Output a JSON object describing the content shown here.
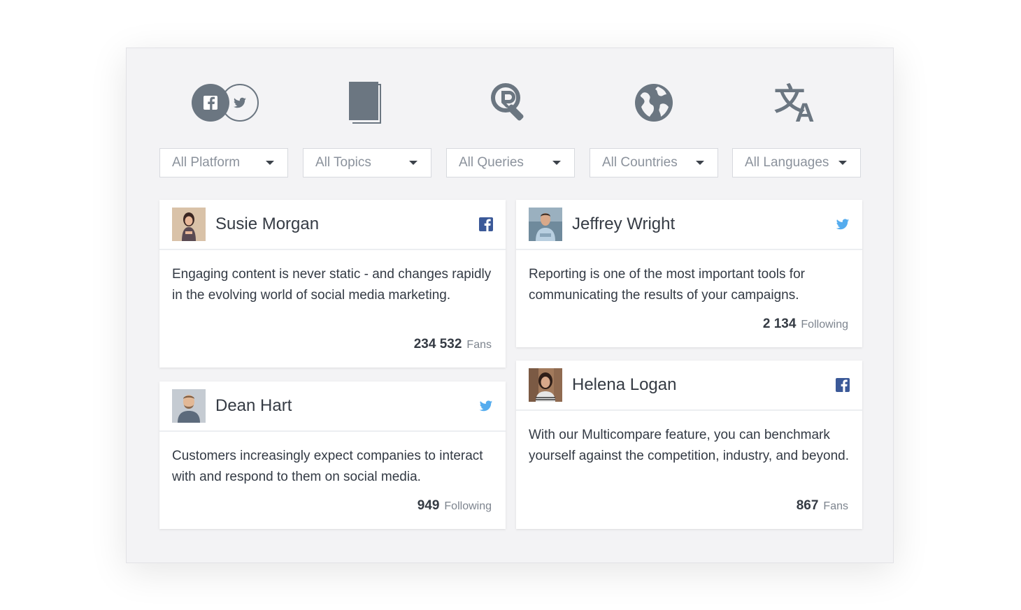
{
  "filters": [
    {
      "icon": "social-platforms-icon",
      "selected": "All Platform"
    },
    {
      "icon": "topics-book-icon",
      "selected": "All Topics"
    },
    {
      "icon": "query-search-icon",
      "selected": "All Queries"
    },
    {
      "icon": "globe-icon",
      "selected": "All Countries"
    },
    {
      "icon": "translate-icon",
      "selected": "All Languages"
    }
  ],
  "cards": [
    {
      "name": "Susie Morgan",
      "network": "facebook",
      "text": "Engaging content is never static - and changes rapidly in the evolving world of social media marketing.",
      "count": "234 532",
      "unit": "Fans"
    },
    {
      "name": "Dean Hart",
      "network": "twitter",
      "text": "Customers increasingly expect companies to interact with and respond to them on social media.",
      "count": "949",
      "unit": "Following"
    },
    {
      "name": "Jeffrey Wright",
      "network": "twitter",
      "text": "Reporting is one of the most important tools for communicating the results of your campaigns.",
      "count": "2 134",
      "unit": "Following"
    },
    {
      "name": "Helena Logan",
      "network": "facebook",
      "text": "With our Multicompare feature, you can benchmark yourself against the competition, industry, and beyond.",
      "count": "867",
      "unit": "Fans"
    }
  ],
  "colors": {
    "icon_gray": "#6b7681",
    "facebook": "#3b5998",
    "twitter": "#55acee",
    "panel_bg": "#f3f3f5"
  }
}
